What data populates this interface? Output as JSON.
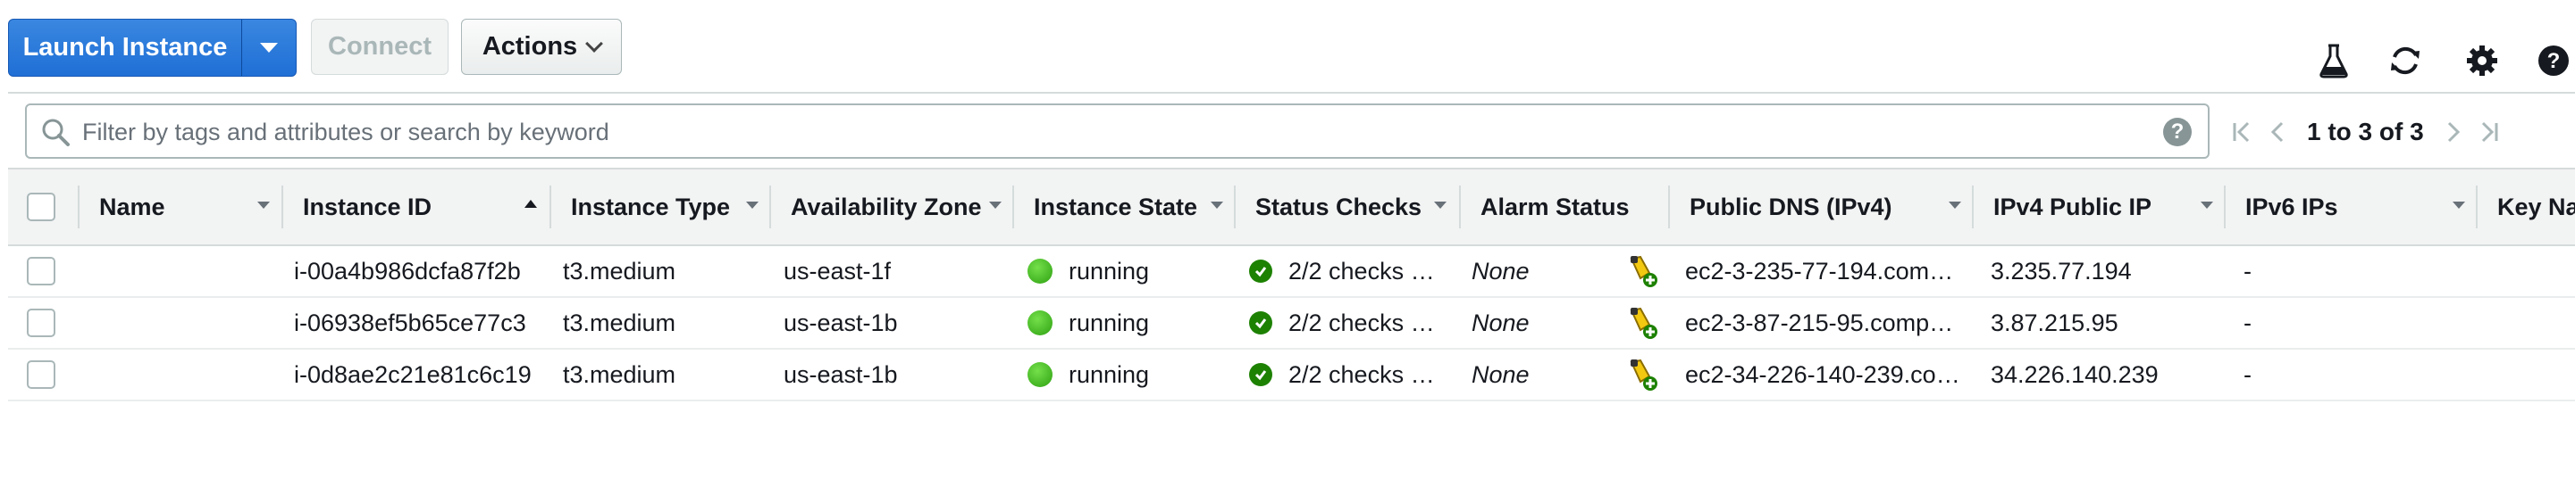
{
  "toolbar": {
    "launch_label": "Launch Instance",
    "connect_label": "Connect",
    "actions_label": "Actions"
  },
  "icons": {
    "experiment": "flask-icon",
    "refresh": "refresh-icon",
    "settings": "gear-icon",
    "help": "help-icon"
  },
  "filter": {
    "placeholder": "Filter by tags and attributes or search by keyword",
    "help_symbol": "?"
  },
  "pagination": {
    "text": "1 to 3 of 3"
  },
  "columns": [
    "Name",
    "Instance ID",
    "Instance Type",
    "Availability Zone",
    "Instance State",
    "Status Checks",
    "Alarm Status",
    "Public DNS (IPv4)",
    "IPv4 Public IP",
    "IPv6 IPs",
    "Key Na"
  ],
  "rows": [
    {
      "name": "",
      "instance_id": "i-00a4b986dcfa87f2b",
      "instance_type": "t3.medium",
      "availability_zone": "us-east-1f",
      "state": "running",
      "status_checks": "2/2 checks …",
      "alarm_status": "None",
      "public_dns": "ec2-3-235-77-194.com…",
      "ipv4": "3.235.77.194",
      "ipv6": "-"
    },
    {
      "name": "",
      "instance_id": "i-06938ef5b65ce77c3",
      "instance_type": "t3.medium",
      "availability_zone": "us-east-1b",
      "state": "running",
      "status_checks": "2/2 checks …",
      "alarm_status": "None",
      "public_dns": "ec2-3-87-215-95.comp…",
      "ipv4": "3.87.215.95",
      "ipv6": "-"
    },
    {
      "name": "",
      "instance_id": "i-0d8ae2c21e81c6c19",
      "instance_type": "t3.medium",
      "availability_zone": "us-east-1b",
      "state": "running",
      "status_checks": "2/2 checks …",
      "alarm_status": "None",
      "public_dns": "ec2-34-226-140-239.co…",
      "ipv4": "34.226.140.239",
      "ipv6": "-"
    }
  ],
  "colors": {
    "primary_button": "#1f6fd6",
    "running_green": "#2ea012",
    "status_ok": "#1d8102",
    "header_bg": "#f2f3f3"
  }
}
